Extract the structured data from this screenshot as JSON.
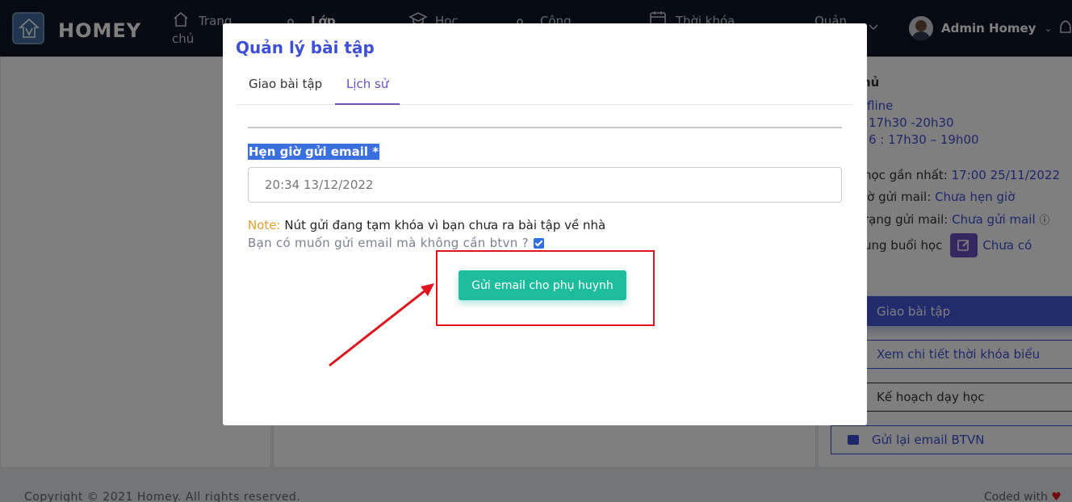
{
  "navbar": {
    "brand": "HOMEY",
    "logo_text": "HOMEY",
    "items": [
      {
        "label_line1": "Trang",
        "label_line2": "chủ",
        "icon": "home-icon"
      },
      {
        "label_line1": "Lớp",
        "label_line2": "",
        "icon": "user-icon"
      },
      {
        "label_line1": "Học",
        "label_line2": "",
        "icon": "graduation-cap-icon"
      },
      {
        "label_line1": "Công",
        "label_line2": "",
        "icon": "user-icon"
      },
      {
        "label_line1": "Thời khóa",
        "label_line2": "",
        "icon": "calendar-icon"
      },
      {
        "label_line1": "Quản",
        "label_line2": "",
        "icon": "chevron-down-icon"
      }
    ],
    "user_name": "Admin Homey",
    "bell_icon": "bell-icon"
  },
  "background": {
    "right_panel": {
      "line_title": "hủ",
      "line_mode": "fline",
      "line_time1": "17h30 -20h30",
      "line_time2": "6 : 17h30 – 19h00",
      "recent_label": "học gần nhất:",
      "recent_value": "17:00 25/11/2022",
      "schedule_label": "iờ gửi mail:",
      "schedule_value": "Chưa hẹn giờ",
      "status_label": "rạng gửi mail:",
      "status_value": "Chưa gửi mail",
      "content_label": "ung buổi học",
      "content_value": "Chưa có",
      "buttons": {
        "assign": "Giao bài tập",
        "view_schedule": "Xem chi tiết thời khóa biểu",
        "plan": "Kế hoạch dạy học",
        "resend": "Gửi lại email BTVN"
      }
    },
    "footer_left": "Copyright © 2021 Homey. All rights reserved.",
    "footer_right": "Coded with"
  },
  "modal": {
    "title": "Quản lý bài tập",
    "tabs": [
      {
        "label": "Giao bài tập",
        "active": false
      },
      {
        "label": "Lịch sử",
        "active": true
      }
    ],
    "schedule_label": "Hẹn giờ gửi email *",
    "schedule_placeholder": "20:34 13/12/2022",
    "note_label": "Note:",
    "note_text": "Nút gửi đang tạm khóa vì bạn chưa ra bài tập về nhà",
    "question_text": "Bạn có muốn gửi email mà không cần btvn ?",
    "checkbox_checked": true,
    "send_button": "Gửi email cho phụ huynh"
  },
  "colors": {
    "accent": "#3d4fd6",
    "send_button": "#1dbc9c",
    "annotation": "#e0141c",
    "navbar": "#0f1626"
  }
}
